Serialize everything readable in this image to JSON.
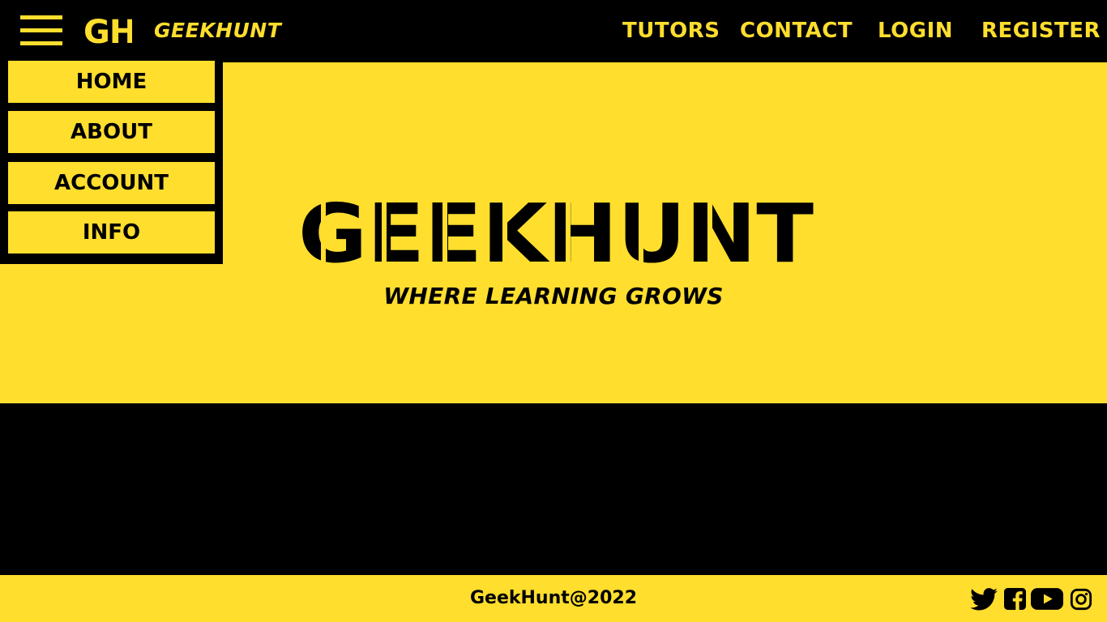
{
  "header": {
    "brand_name": "GEEKHUNT",
    "logo_text": "GH",
    "nav": [
      "TUTORS",
      "CONTACT",
      "LOGIN",
      "REGISTER"
    ]
  },
  "menu": {
    "items": [
      "HOME",
      "ABOUT",
      "ACCOUNT",
      "INFO"
    ]
  },
  "hero": {
    "title": "GEEKHUNT",
    "tagline": "WHERE LEARNING GROWS"
  },
  "footer": {
    "copyright": "GeekHunt@2022",
    "social_icons": [
      "twitter-icon",
      "facebook-icon",
      "youtube-icon",
      "instagram-icon"
    ]
  },
  "colors": {
    "brand_yellow": "#ffde2e",
    "black": "#000000"
  }
}
